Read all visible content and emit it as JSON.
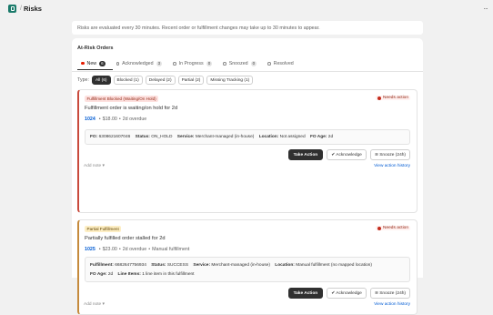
{
  "header": {
    "breadcrumb_sep": "/",
    "title": "Risks",
    "more_icon": "..."
  },
  "banner": {
    "text": "Risks are evaluated every 30 minutes. Recent order or fulfillment changes may take up to 30 minutes to appear."
  },
  "card": {
    "title": "At-Risk Orders",
    "tabs": [
      {
        "label": "New",
        "count": "6"
      },
      {
        "label": "Acknowledged",
        "count": "3"
      },
      {
        "label": "In Progress",
        "count": "0"
      },
      {
        "label": "Snoozed",
        "count": "0"
      },
      {
        "label": "Resolved",
        "count": ""
      }
    ],
    "type_label": "Type:",
    "type_filters": [
      "All (6)",
      "Blocked (1)",
      "Delayed (2)",
      "Partial (2)",
      "Missing Tracking (1)"
    ]
  },
  "orders": [
    {
      "badge": "Fulfillment Blocked (Waiting/On Hold)",
      "status": "Needs action",
      "headline": "Fulfillment order is waiting/on hold for 2d",
      "order_number": "1024",
      "amount": "$18.00",
      "age": "2d overdue",
      "extra": "",
      "details_line1": [
        {
          "k": "FO:",
          "v": "6308621607046"
        },
        {
          "k": "Status:",
          "v": "ON_HOLD"
        },
        {
          "k": "Service:",
          "v": "Merchant-managed (in-house)"
        },
        {
          "k": "Location:",
          "v": "Not assigned"
        },
        {
          "k": "FO Age:",
          "v": "2d"
        }
      ],
      "details_line2": [],
      "primary_action": "Take Action",
      "acknowledge": "✔ Acknowledge",
      "snooze": "≋ Snooze (24h)",
      "add_note": "Add note ▾",
      "history": "View action history"
    },
    {
      "badge": "Partial Fulfillment",
      "status": "Needs action",
      "headline": "Partially fulfilled order stalled for 2d",
      "order_number": "1025",
      "amount": "$23.00",
      "age": "2d overdue",
      "extra": "Manual fulfillment",
      "details_line1": [
        {
          "k": "Fulfillment:",
          "v": "6682647756934"
        },
        {
          "k": "Status:",
          "v": "SUCCESS"
        },
        {
          "k": "Service:",
          "v": "Merchant-managed (in-house)"
        },
        {
          "k": "Location:",
          "v": "Manual fulfillment (no mapped location)"
        }
      ],
      "details_line2": [
        {
          "k": "FO Age:",
          "v": "2d"
        },
        {
          "k": "Line Items:",
          "v": "1 line item in this fulfillment"
        }
      ],
      "primary_action": "Take Action",
      "acknowledge": "✔ Acknowledge",
      "snooze": "≋ Snooze (24h)",
      "add_note": "Add note ▾",
      "history": "View action history"
    }
  ]
}
